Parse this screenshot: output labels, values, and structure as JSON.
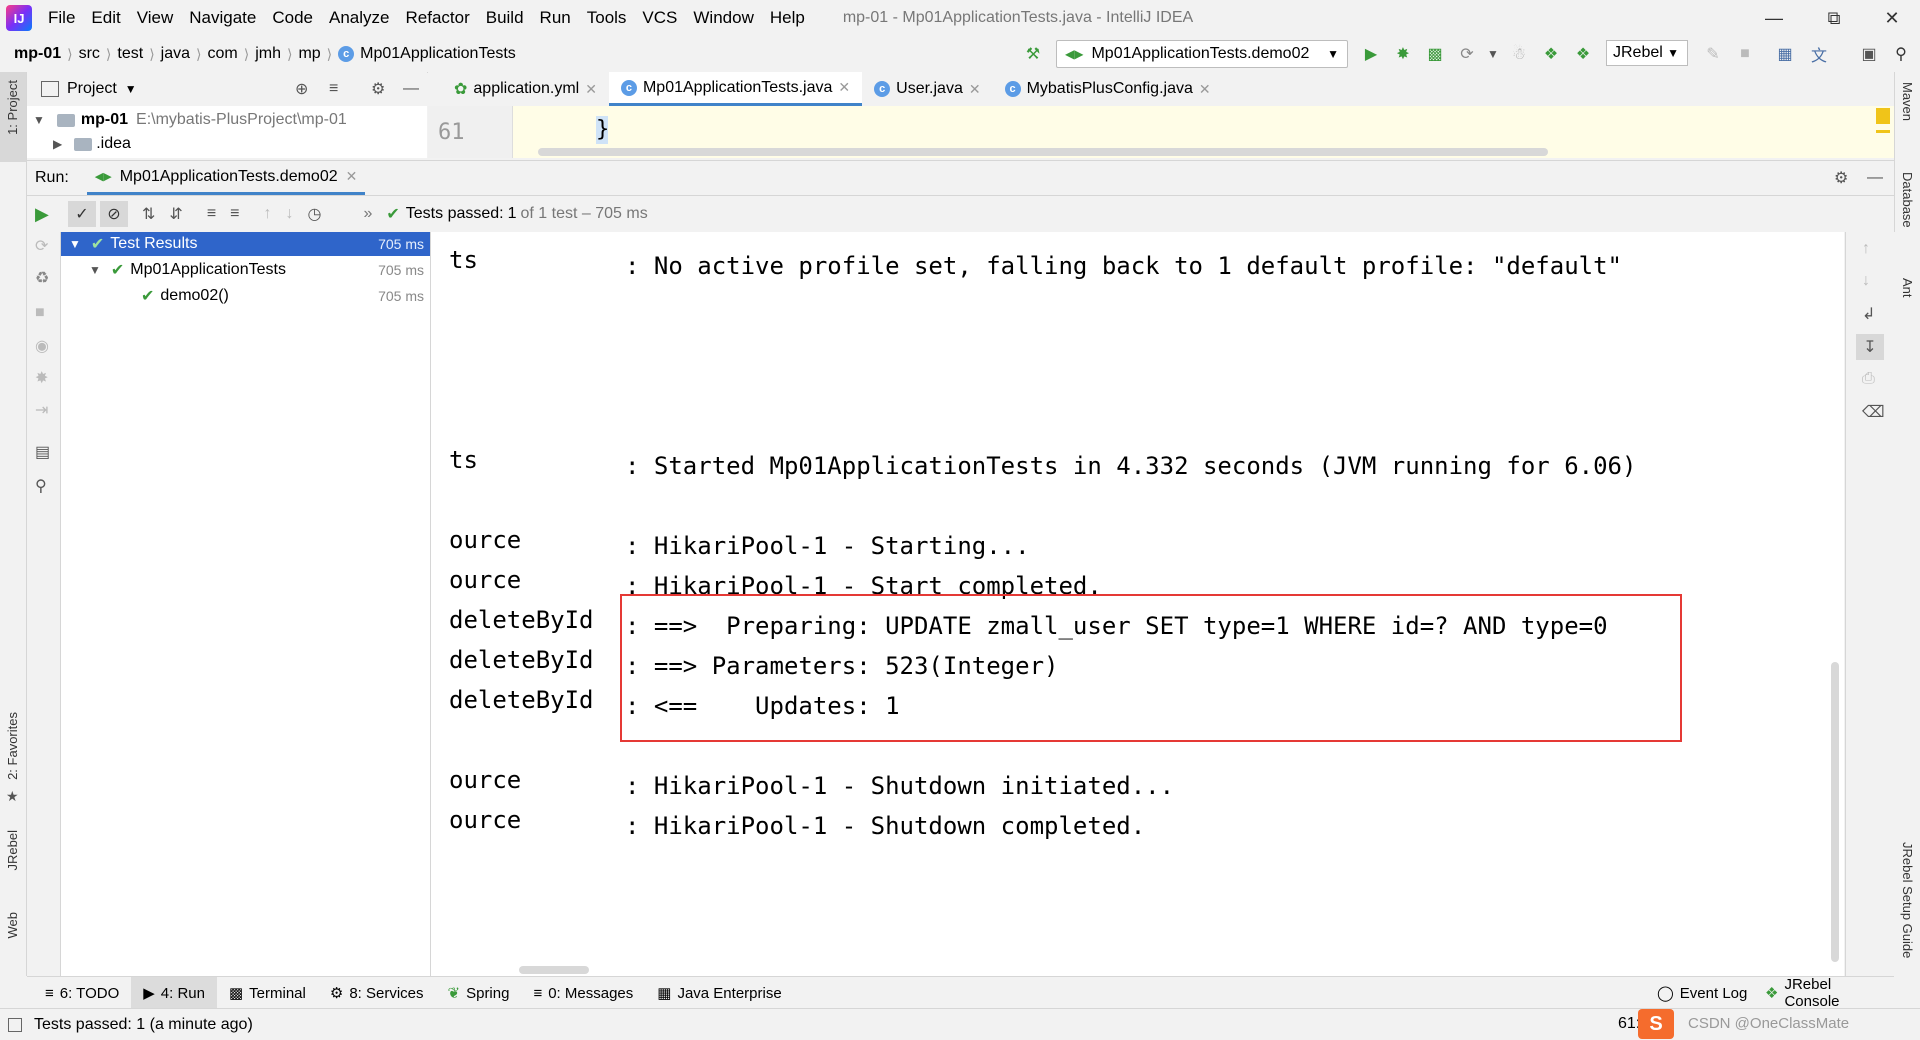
{
  "window": {
    "title": "mp-01 - Mp01ApplicationTests.java - IntelliJ IDEA",
    "app_icon_label": "IJ"
  },
  "menu": [
    "File",
    "Edit",
    "View",
    "Navigate",
    "Code",
    "Analyze",
    "Refactor",
    "Build",
    "Run",
    "Tools",
    "VCS",
    "Window",
    "Help"
  ],
  "breadcrumbs": [
    "mp-01",
    "src",
    "test",
    "java",
    "com",
    "jmh",
    "mp",
    "Mp01ApplicationTests"
  ],
  "toolbar": {
    "run_config": "Mp01ApplicationTests.demo02",
    "jrebel": "JRebel"
  },
  "project_panel": {
    "title": "Project",
    "root_name": "mp-01",
    "root_path": "E:\\mybatis-PlusProject\\mp-01",
    "child": ".idea",
    "stripe_label": "1: Project"
  },
  "editor": {
    "tabs": [
      {
        "label": "application.yml"
      },
      {
        "label": "Mp01ApplicationTests.java"
      },
      {
        "label": "User.java"
      },
      {
        "label": "MybatisPlusConfig.java"
      }
    ],
    "line_number": "61",
    "code": "}"
  },
  "run": {
    "label": "Run:",
    "tab": "Mp01ApplicationTests.demo02",
    "status_prefix": "Tests passed:",
    "status_count": "1",
    "status_rest": "of 1 test – 705 ms"
  },
  "results": [
    {
      "label": "Test Results",
      "time": "705 ms"
    },
    {
      "label": "Mp01ApplicationTests",
      "time": "705 ms"
    },
    {
      "label": "demo02()",
      "time": "705 ms"
    }
  ],
  "console": [
    {
      "src": "ts",
      "msg": ": No active profile set, falling back to 1 default profile: \"default\""
    },
    {
      "src": "ts",
      "msg": ": Started Mp01ApplicationTests in 4.332 seconds (JVM running for 6.06)"
    },
    {
      "src": "ource",
      "msg": ": HikariPool-1 - Starting..."
    },
    {
      "src": "ource",
      "msg": ": HikariPool-1 - Start completed."
    },
    {
      "src": "deleteById",
      "msg": ": ==>  Preparing: UPDATE zmall_user SET type=1 WHERE id=? AND type=0"
    },
    {
      "src": "deleteById",
      "msg": ": ==> Parameters: 523(Integer)"
    },
    {
      "src": "deleteById",
      "msg": ": <==    Updates: 1"
    },
    {
      "src": "ource",
      "msg": ": HikariPool-1 - Shutdown initiated..."
    },
    {
      "src": "ource",
      "msg": ": HikariPool-1 - Shutdown completed."
    }
  ],
  "bottom_tabs": [
    "6: TODO",
    "4: Run",
    "Terminal",
    "8: Services",
    "Spring",
    "0: Messages",
    "Java Enterprise"
  ],
  "bottom_right": [
    "Event Log",
    "JRebel Console"
  ],
  "right_stripe": [
    "Maven",
    "Database",
    "Ant",
    "JRebel Setup Guide"
  ],
  "left_stripe": [
    "2: Favorites",
    "JRebel",
    "Web"
  ],
  "status": {
    "text": "Tests passed: 1 (a minute ago)",
    "position": "61:",
    "watermark": "CSDN @OneClassMate"
  },
  "colors": {
    "highlight": "#e53935",
    "selection": "#2f65ca",
    "pass": "#3a9a3a"
  }
}
